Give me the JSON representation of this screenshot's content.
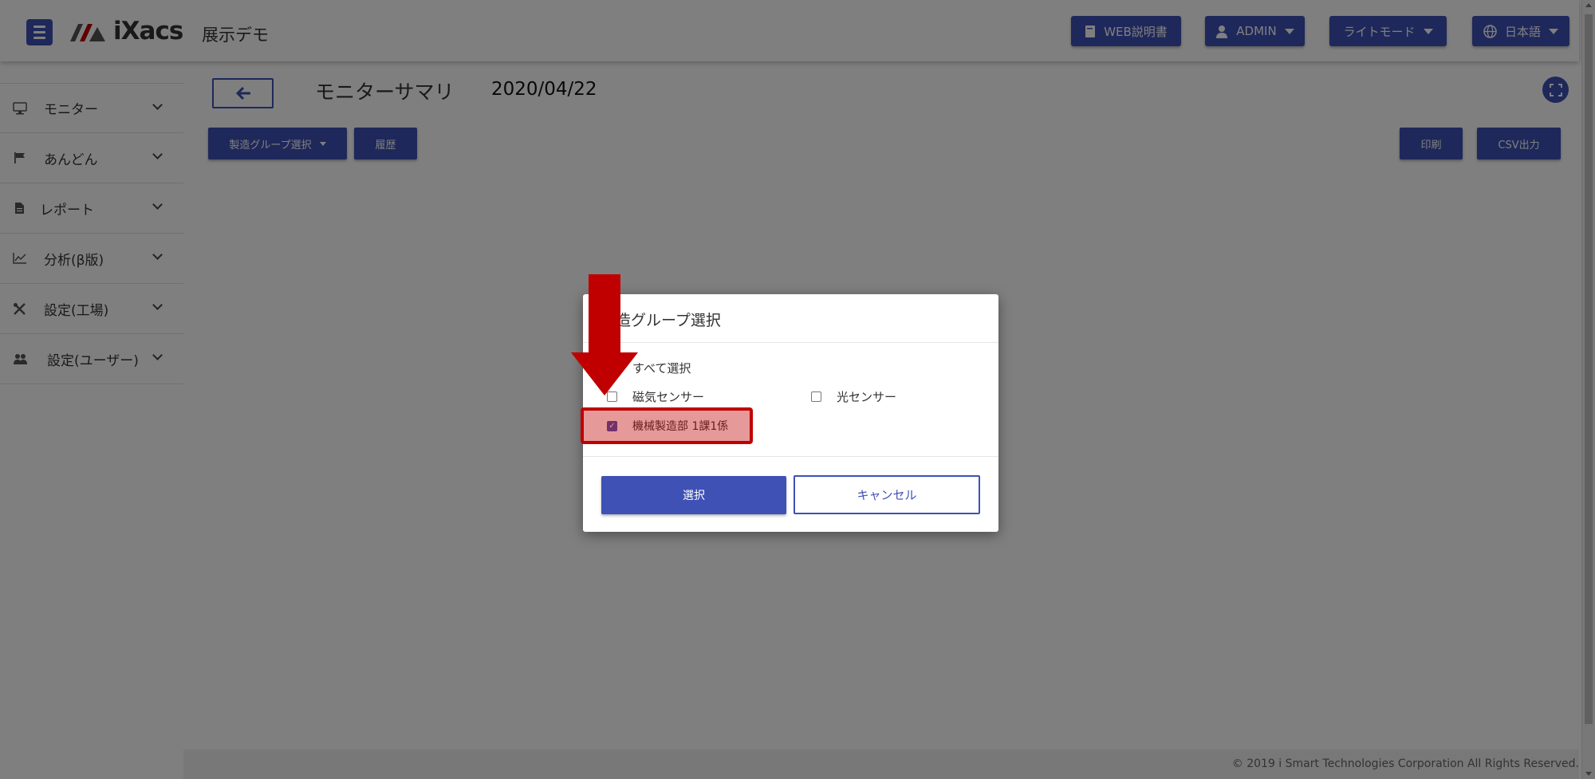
{
  "header": {
    "logo_text": "iXacs",
    "app_title": "展示デモ",
    "web_manual": "WEB説明書",
    "user": "ADMIN",
    "theme": "ライトモード",
    "language": "日本語"
  },
  "sidebar": {
    "items": [
      {
        "label": "モニター",
        "icon": "monitor-icon"
      },
      {
        "label": "あんどん",
        "icon": "flag-icon"
      },
      {
        "label": "レポート",
        "icon": "document-icon"
      },
      {
        "label": "分析(β版)",
        "icon": "chart-line-icon"
      },
      {
        "label": "設定(工場)",
        "icon": "tools-icon"
      },
      {
        "label": "設定(ユーザー)",
        "icon": "users-icon"
      }
    ]
  },
  "page": {
    "title": "モニターサマリ",
    "date": "2020/04/22",
    "group_select": "製造グループ選択",
    "history": "履歴",
    "print": "印刷",
    "csv": "CSV出力"
  },
  "modal": {
    "title": "製造グループ選択",
    "select_all": "すべて選択",
    "options": [
      {
        "label": "磁気センサー",
        "checked": false
      },
      {
        "label": "光センサー",
        "checked": false
      },
      {
        "label": "機械製造部 1課1係",
        "checked": true
      }
    ],
    "select_button": "選択",
    "cancel_button": "キャンセル"
  },
  "footer": {
    "copyright": "© 2019 i Smart Technologies Corporation All Rights Reserved."
  },
  "colors": {
    "primary": "#3f51b5",
    "annotation_red": "#c00000"
  }
}
